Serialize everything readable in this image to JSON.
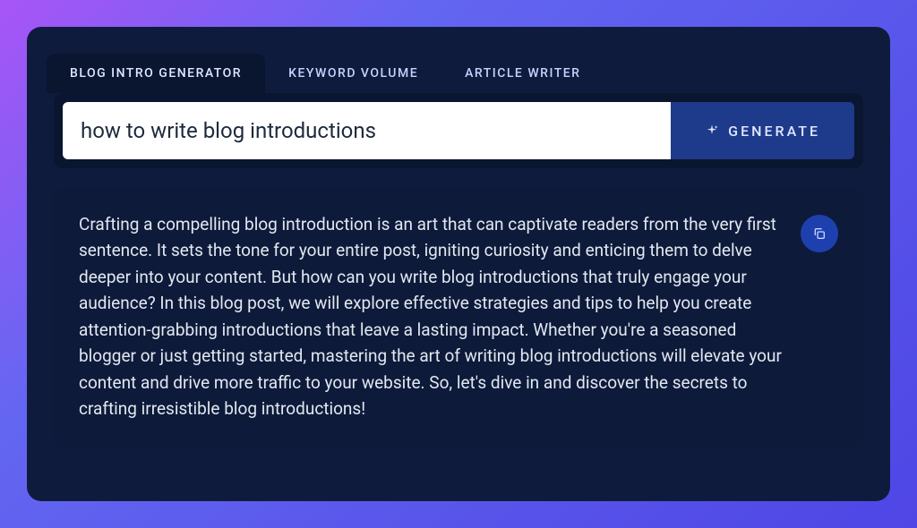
{
  "tabs": {
    "items": [
      {
        "label": "BLOG INTRO GENERATOR",
        "active": true
      },
      {
        "label": "KEYWORD VOLUME",
        "active": false
      },
      {
        "label": "ARTICLE WRITER",
        "active": false
      }
    ]
  },
  "input": {
    "value": "how to write blog introductions"
  },
  "generate": {
    "label": "GENERATE"
  },
  "output": {
    "text": "Crafting a compelling blog introduction is an art that can captivate readers from the very first sentence. It sets the tone for your entire post, igniting curiosity and enticing them to delve deeper into your content. But how can you write blog introductions that truly engage your audience? In this blog post, we will explore effective strategies and tips to help you create attention-grabbing introductions that leave a lasting impact. Whether you're a seasoned blogger or just getting started, mastering the art of writing blog introductions will elevate your content and drive more traffic to your website. So, let's dive in and discover the secrets to crafting irresistible blog introductions!"
  },
  "icons": {
    "sparkle": "sparkle-icon",
    "copy": "copy-icon"
  }
}
